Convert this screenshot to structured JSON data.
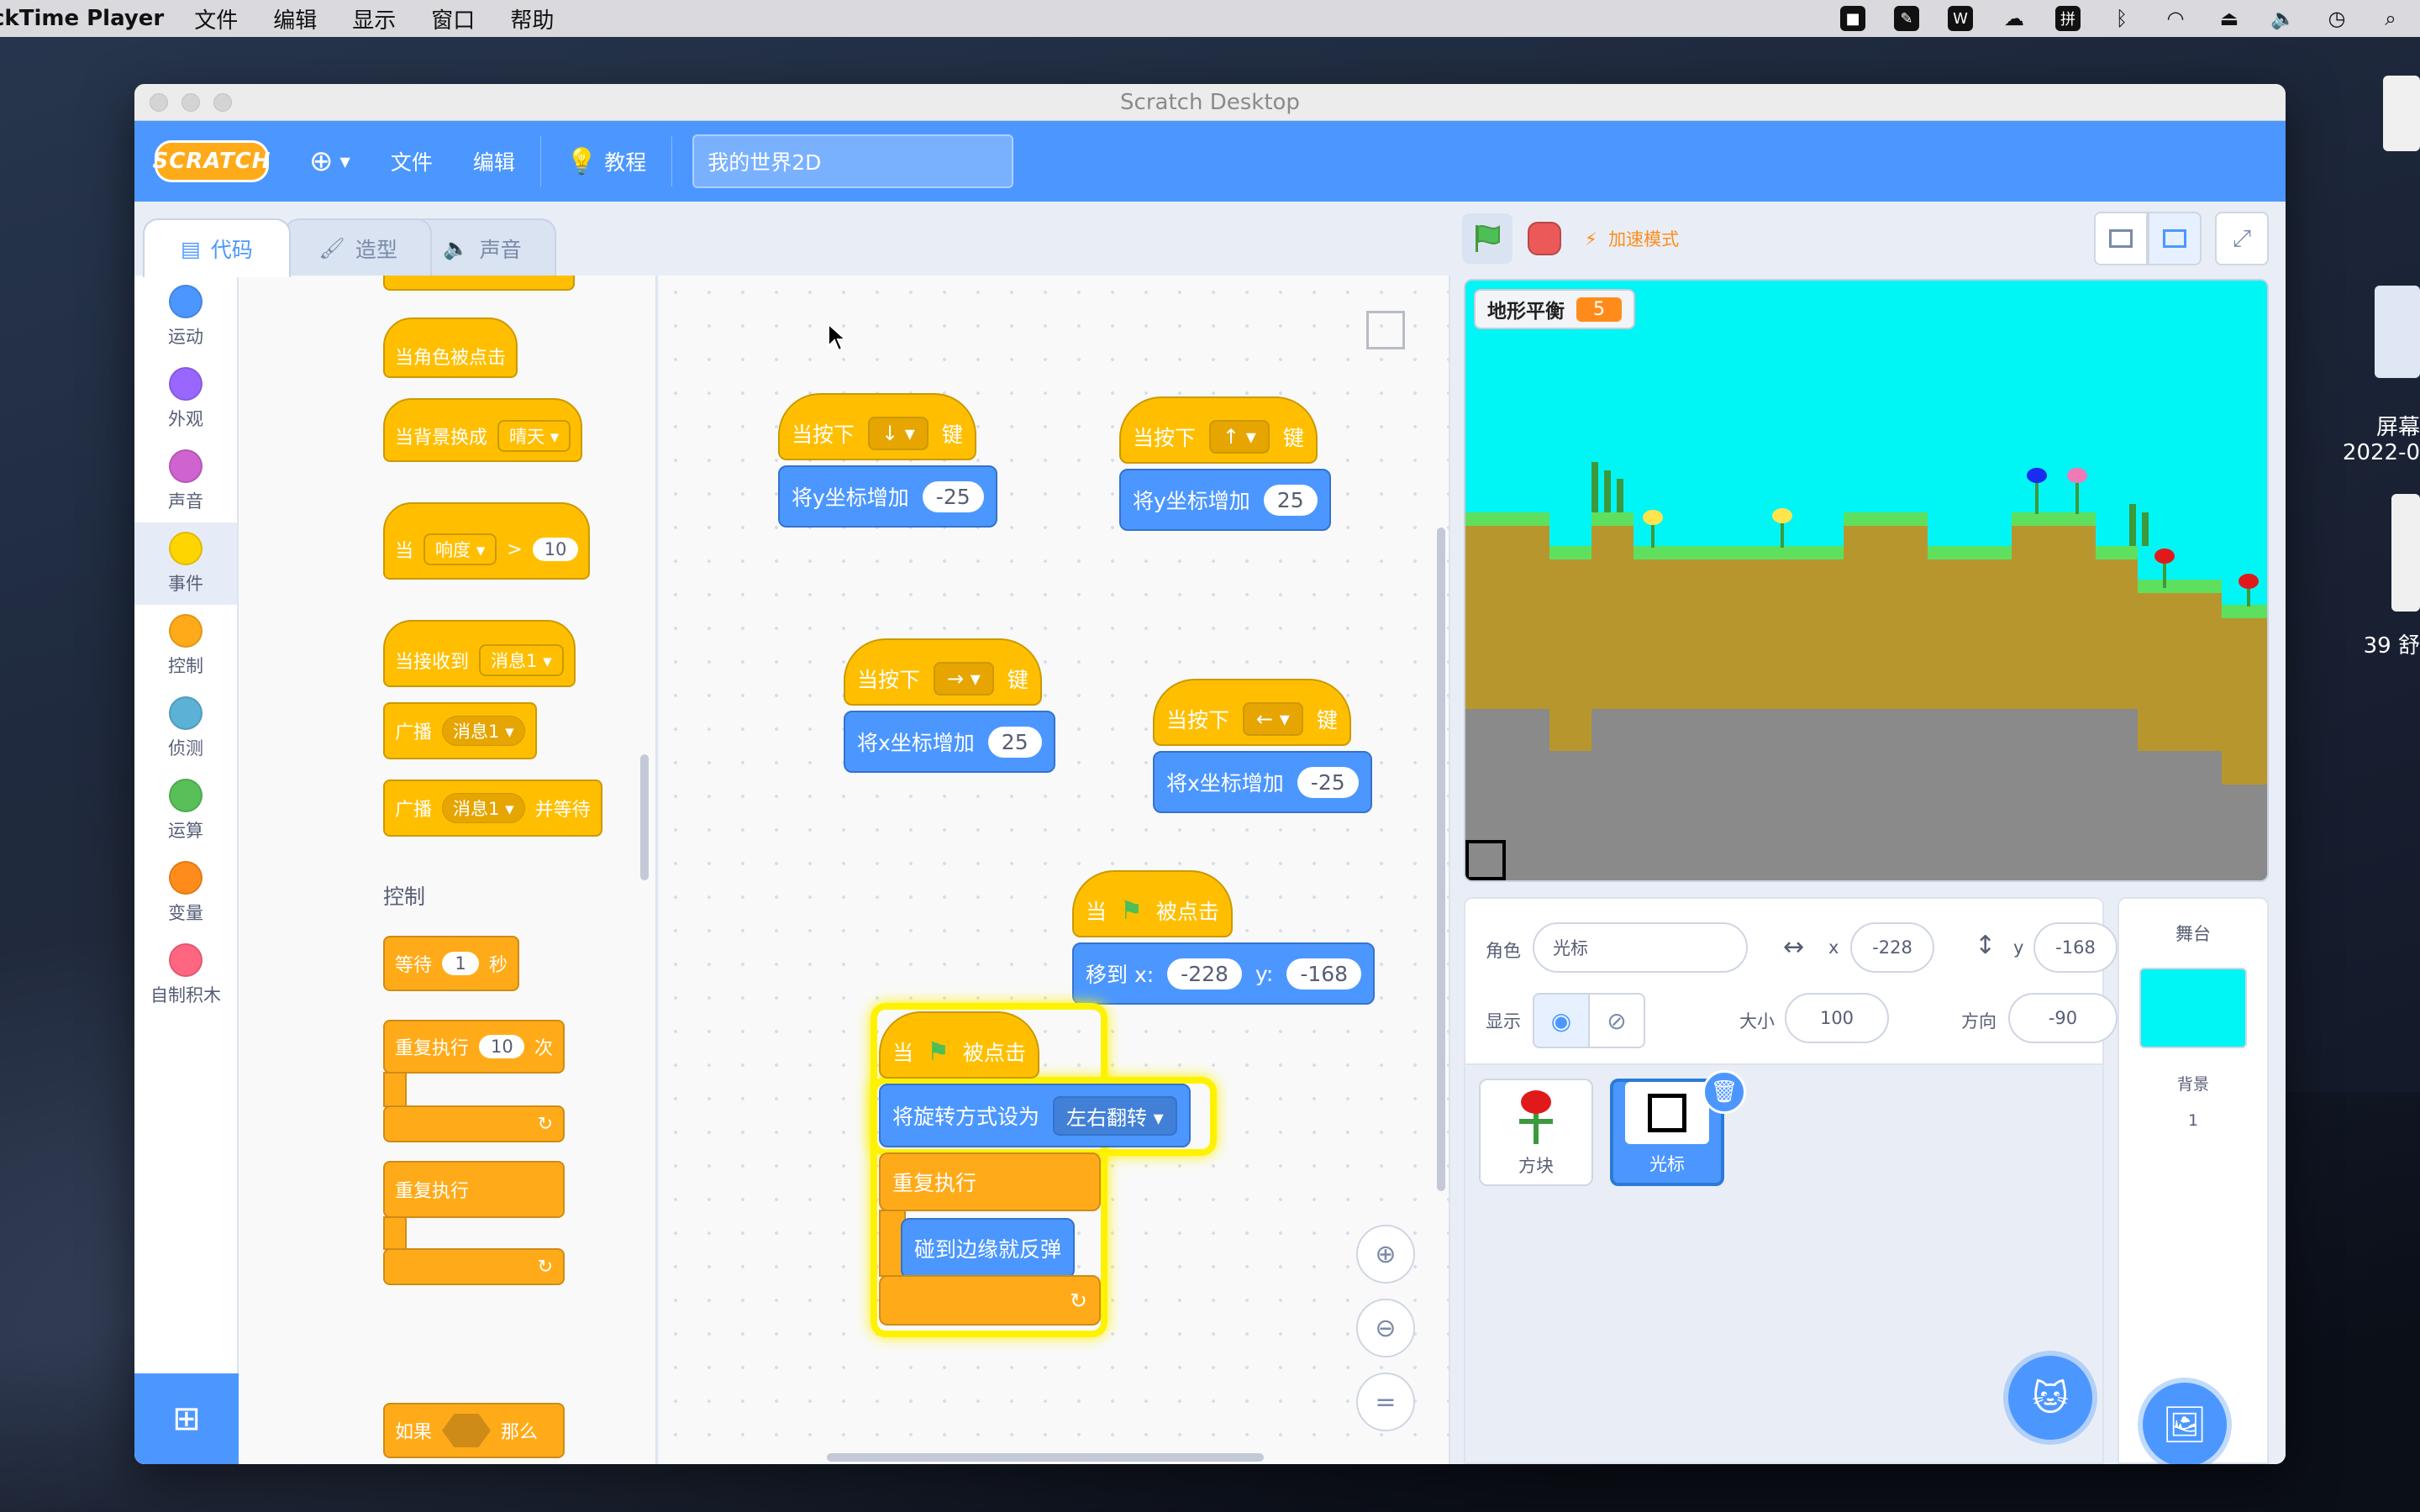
{
  "menubar": {
    "app": "ckTime Player",
    "items": [
      "文件",
      "编辑",
      "显示",
      "窗口",
      "帮助"
    ]
  },
  "desktop": {
    "label1": "屏幕",
    "label2": "2022-0",
    "label3": "39 舒"
  },
  "window": {
    "title": "Scratch Desktop"
  },
  "scratch_menu": {
    "logo": "SCRATCH",
    "file": "文件",
    "edit": "编辑",
    "tutorials": "教程",
    "project_title": "我的世界2D"
  },
  "tabs": {
    "code": "代码",
    "costumes": "造型",
    "sounds": "声音"
  },
  "categories": [
    {
      "label": "运动",
      "color": "#4c97ff"
    },
    {
      "label": "外观",
      "color": "#9966ff"
    },
    {
      "label": "声音",
      "color": "#cf63cf"
    },
    {
      "label": "事件",
      "color": "#ffd500"
    },
    {
      "label": "控制",
      "color": "#ffab19"
    },
    {
      "label": "侦测",
      "color": "#5cb1d6"
    },
    {
      "label": "运算",
      "color": "#59c059"
    },
    {
      "label": "变量",
      "color": "#ff8c1a"
    },
    {
      "label": "自制积木",
      "color": "#ff6680"
    }
  ],
  "palette": {
    "when_sprite_clicked": "当角色被点击",
    "when_backdrop_switches": "当背景换成",
    "backdrop_option": "晴天",
    "when": "当",
    "loudness": "响度",
    "gt": ">",
    "loudness_value": "10",
    "when_receive": "当接收到",
    "message1": "消息1",
    "broadcast": "广播",
    "and_wait": "并等待",
    "control_header": "控制",
    "wait": "等待",
    "wait_value": "1",
    "seconds": "秒",
    "repeat": "重复执行",
    "repeat_value": "10",
    "times": "次",
    "forever": "重复执行",
    "if": "如果",
    "then": "那么"
  },
  "code": {
    "key_pressed_prefix": "当按下",
    "key_suffix": "键",
    "key_down": "↓",
    "key_up": "↑",
    "key_right": "→",
    "key_left": "←",
    "change_y": "将y坐标增加",
    "change_x": "将x坐标增加",
    "val_neg25": "-25",
    "val_25": "25",
    "when": "当",
    "flag_clicked": "被点击",
    "goto_x": "移到 x:",
    "goto_y": "y:",
    "goto_x_val": "-228",
    "goto_y_val": "-168",
    "set_rotation": "将旋转方式设为",
    "rotation_option": "左右翻转",
    "forever": "重复执行",
    "bounce": "碰到边缘就反弹"
  },
  "stage_header": {
    "turbo": "加速模式"
  },
  "stage": {
    "monitor_label": "地形平衡",
    "monitor_value": "5"
  },
  "sprite_info": {
    "sprite_label": "角色",
    "sprite_name": "光标",
    "x_label": "x",
    "x_value": "-228",
    "y_label": "y",
    "y_value": "-168",
    "show_label": "显示",
    "size_label": "大小",
    "size_value": "100",
    "direction_label": "方向",
    "direction_value": "-90"
  },
  "sprites": [
    {
      "name": "方块",
      "selected": false
    },
    {
      "name": "光标",
      "selected": true
    }
  ],
  "stage_pane": {
    "title": "舞台",
    "backdrop_label": "背景",
    "backdrop_count": "1"
  }
}
